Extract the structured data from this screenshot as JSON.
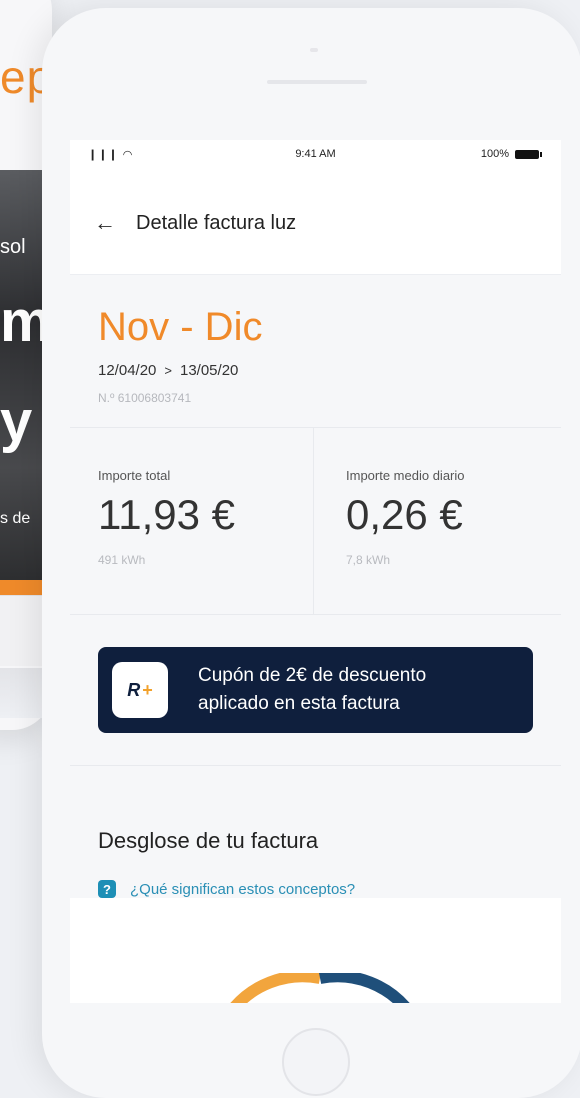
{
  "background_app": {
    "heading_partial": "ep:",
    "photo_texts": [
      "sol",
      "m",
      "y",
      "s de"
    ]
  },
  "statusbar": {
    "signal": "❙❙❙ ◠",
    "time": "9:41 AM",
    "battery": "100%"
  },
  "appbar": {
    "back_icon": "←",
    "title": "Detalle factura luz"
  },
  "invoice": {
    "period": "Nov - Dic",
    "date_start": "12/04/20",
    "date_arrow": ">",
    "date_end": "13/05/20",
    "number": "N.º 61006803741"
  },
  "amounts": {
    "total_label": "Importe total",
    "total_value": "11,93 €",
    "total_kwh": "491 kWh",
    "daily_label": "Importe medio diario",
    "daily_value": "0,26 €",
    "daily_kwh": "7,8 kWh"
  },
  "coupon": {
    "logo_r": "R",
    "logo_plus": "+",
    "line1": "Cupón de 2€ de descuento",
    "line2": "aplicado en esta factura"
  },
  "breakdown": {
    "title": "Desglose de tu factura",
    "help_icon": "?",
    "help_text": "¿Qué significan estos conceptos?"
  },
  "colors": {
    "accent_orange": "#f08a2a",
    "navy": "#0f1f3d",
    "link_blue": "#2a8fb5",
    "donut_blue": "#1f4f7a"
  }
}
